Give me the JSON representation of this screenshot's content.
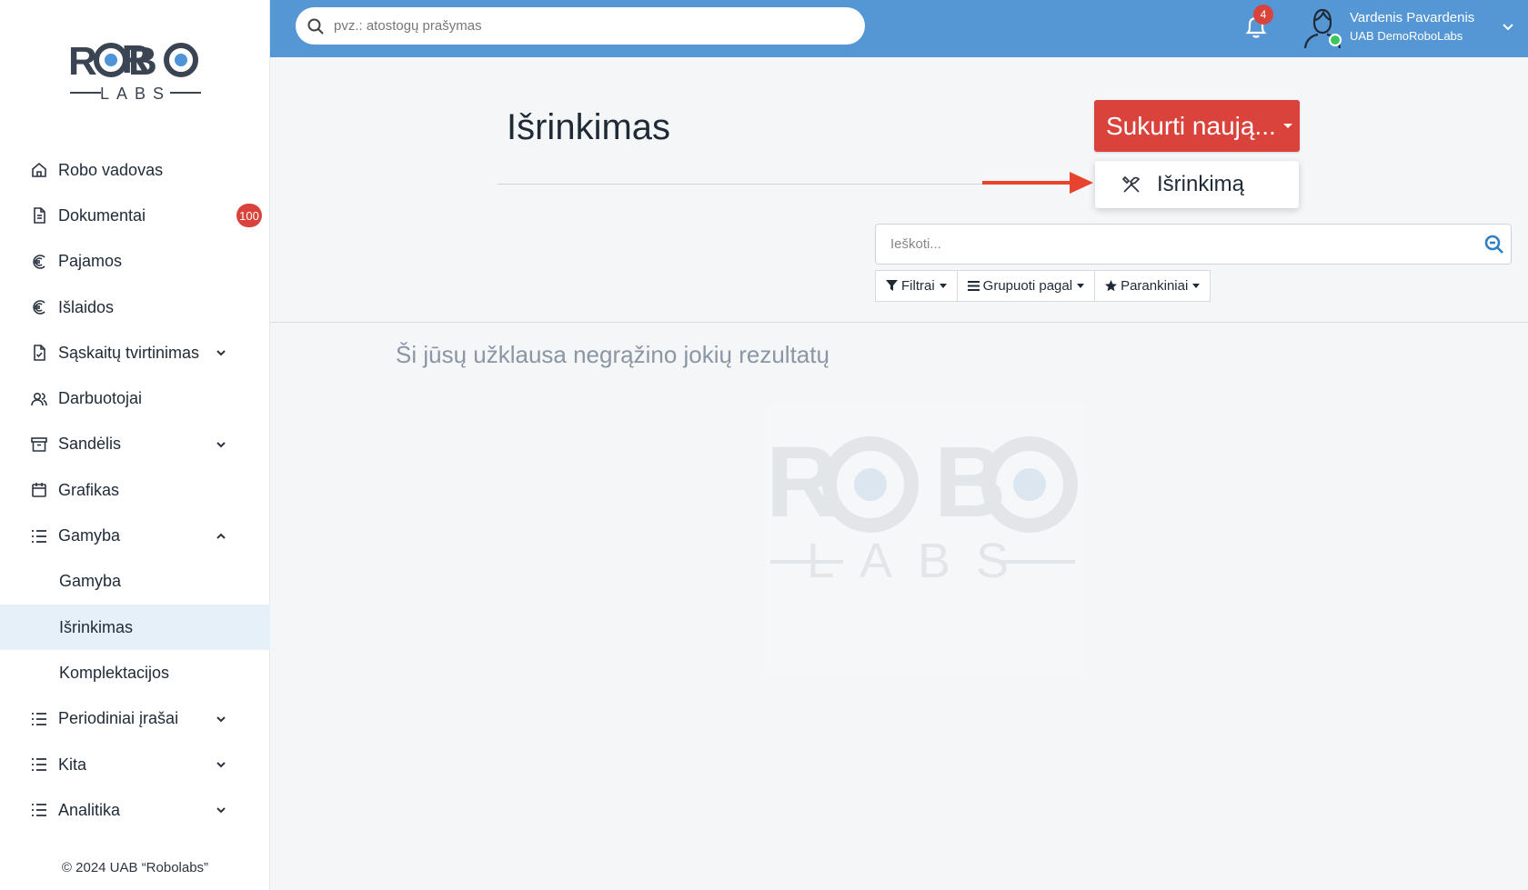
{
  "sidebar": {
    "logo_text_top": "ROBO",
    "logo_text_bottom": "LABS",
    "items": [
      {
        "label": "Robo vadovas",
        "icon": "home-icon"
      },
      {
        "label": "Dokumentai",
        "icon": "document-icon",
        "badge": "100"
      },
      {
        "label": "Pajamos",
        "icon": "euro-icon"
      },
      {
        "label": "Išlaidos",
        "icon": "euro-icon"
      },
      {
        "label": "Sąskaitų tvirtinimas",
        "icon": "file-check-icon",
        "expandable": true
      },
      {
        "label": "Darbuotojai",
        "icon": "users-icon"
      },
      {
        "label": "Sandėlis",
        "icon": "archive-icon",
        "expandable": true
      },
      {
        "label": "Grafikas",
        "icon": "calendar-icon"
      },
      {
        "label": "Gamyba",
        "icon": "list-icon",
        "expanded": true
      },
      {
        "label": "Gamyba",
        "sub": true
      },
      {
        "label": "Išrinkimas",
        "sub": true,
        "active": true
      },
      {
        "label": "Komplektacijos",
        "sub": true
      },
      {
        "label": "Periodiniai įrašai",
        "icon": "list-icon",
        "expandable": true
      },
      {
        "label": "Kita",
        "icon": "list-icon",
        "expandable": true
      },
      {
        "label": "Analitika",
        "icon": "list-icon",
        "expandable": true
      }
    ],
    "copyright": "© 2024 UAB “Robolabs”"
  },
  "header": {
    "search_placeholder": "pvz.: atostogų prašymas",
    "notifications_count": "4",
    "user_name": "Vardenis Pavardenis",
    "company": "UAB DemoRoboLabs",
    "online_color": "#3cc45d",
    "bar_color": "#5596d5"
  },
  "main": {
    "title": "Išrinkimas",
    "create_button": "Sukurti naują...",
    "dropdown_item": "Išrinkimą",
    "search_placeholder": "Ieškoti...",
    "filters": [
      "Filtrai",
      "Grupuoti pagal",
      "Parankiniai"
    ],
    "empty_message": "Ši jūsų užklausa negrąžino jokių rezultatų",
    "accent_color": "#d9433b"
  }
}
